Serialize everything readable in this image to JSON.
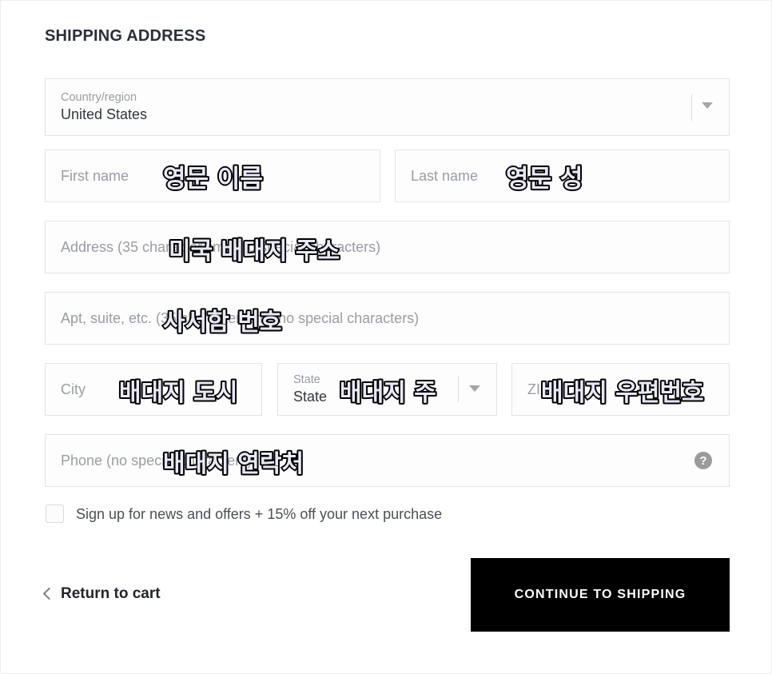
{
  "section": {
    "title": "SHIPPING ADDRESS"
  },
  "form": {
    "country": {
      "label": "Country/region",
      "value": "United States",
      "caret_icon": "chevron-down-icon"
    },
    "first_name": {
      "placeholder": "First name"
    },
    "last_name": {
      "placeholder": "Last name"
    },
    "address": {
      "placeholder": "Address (35 character limit, no special characters)"
    },
    "address2": {
      "placeholder": "Apt, suite, etc. (35 character limit, no special characters)"
    },
    "city": {
      "placeholder": "City"
    },
    "state": {
      "label": "State",
      "value": "State",
      "caret_icon": "chevron-down-icon"
    },
    "zip": {
      "placeholder": "ZIP"
    },
    "phone": {
      "placeholder": "Phone (no special characters)",
      "help_icon": "question-mark-circle-icon"
    },
    "newsletter": {
      "label": "Sign up for news and offers + 15% off your next purchase",
      "checked": false
    }
  },
  "actions": {
    "return_to_cart": "Return to cart",
    "return_icon": "chevron-left-icon",
    "continue": "CONTINUE TO SHIPPING"
  },
  "annotations": [
    {
      "text": "영문 이름"
    },
    {
      "text": "영문 성"
    },
    {
      "text": "미국 배대지 주소"
    },
    {
      "text": "사서함 번호"
    },
    {
      "text": "배대지 도시"
    },
    {
      "text": "배대지 주"
    },
    {
      "text": "배대지 우편번호"
    },
    {
      "text": "배대지 연락처"
    }
  ],
  "colors": {
    "accent": "#000000",
    "text": "#2b2f38",
    "muted": "#9a9da4",
    "border": "#e4e4e6",
    "annotation_fill": "#e8e8f6",
    "annotation_stroke": "#000000"
  }
}
